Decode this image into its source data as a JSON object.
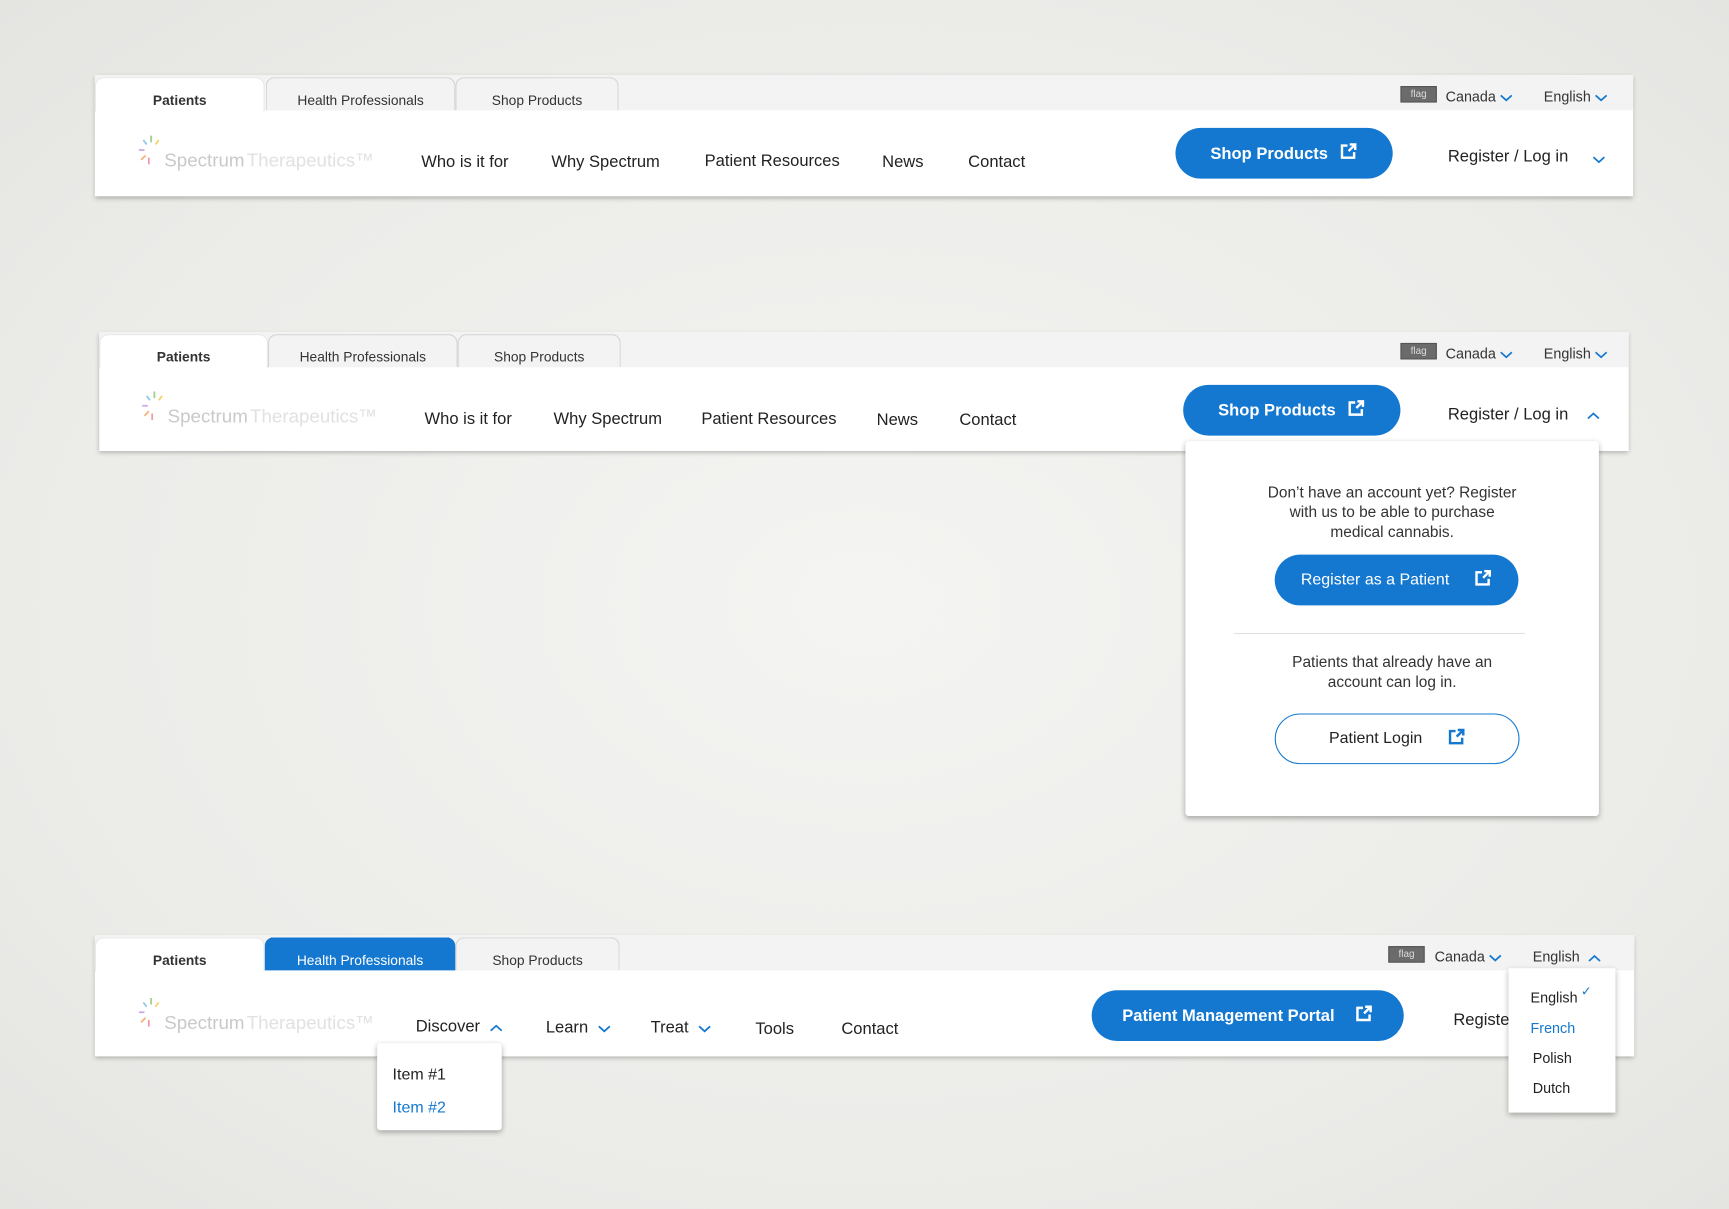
{
  "colors": {
    "accent": "#1478d0",
    "tabbar": "#f3f3f3",
    "text": "#222222"
  },
  "logo": {
    "word1": "Spectrum",
    "word2": "Therapeutics",
    "tm": "™"
  },
  "tabs": [
    "Patients",
    "Health Professionals",
    "Shop Products"
  ],
  "utility": {
    "flag_alt": "flag",
    "country": "Canada",
    "language": "English"
  },
  "patient_nav": [
    "Who is it for",
    "Why Spectrum",
    "Patient Resources",
    "News",
    "Contact"
  ],
  "hcp_nav": [
    "Discover",
    "Learn",
    "Treat",
    "Tools",
    "Contact"
  ],
  "shop_button": "Shop Products",
  "portal_button": "Patient Management Portal",
  "register_login": "Register / Log in",
  "register_truncated": "Registe",
  "account_dropdown": {
    "register_text": "Don’t have an account yet? Register with us to be able to purchase medical cannabis.",
    "register_text_lines": [
      "Don’t have an account yet? Register",
      "with us to be able to purchase",
      "medical cannabis."
    ],
    "register_button": "Register as a Patient",
    "login_text_lines": [
      "Patients that already have an",
      "account can log in."
    ],
    "login_button": "Patient Login"
  },
  "discover_menu": {
    "items": [
      "Item #1",
      "Item #2"
    ],
    "hovered": "Item #2"
  },
  "language_menu": {
    "options": [
      "English",
      "French",
      "Polish",
      "Dutch"
    ],
    "selected": "English",
    "hovered": "French"
  }
}
